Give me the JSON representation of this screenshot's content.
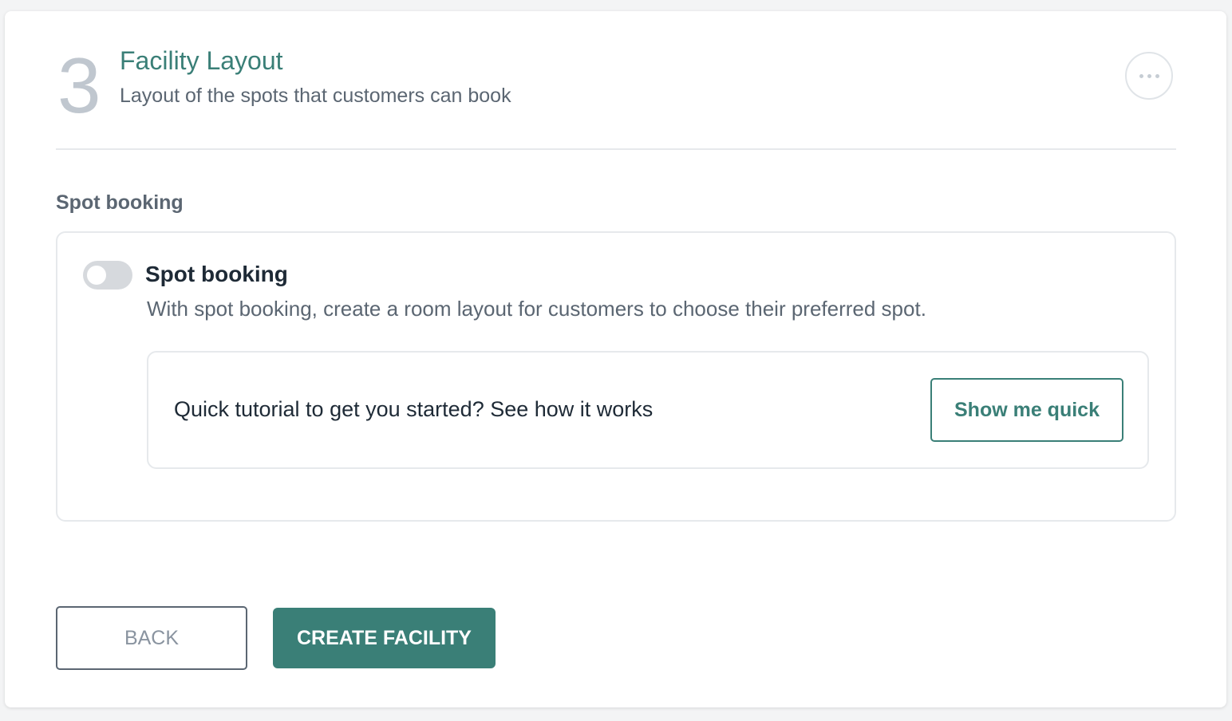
{
  "step": {
    "number": "3",
    "title": "Facility Layout",
    "subtitle": "Layout of the spots that customers can book"
  },
  "section": {
    "label": "Spot booking"
  },
  "spot_booking": {
    "toggle_label": "Spot booking",
    "toggle_enabled": false,
    "description": "With spot booking, create a room layout for customers to choose their preferred spot."
  },
  "tutorial": {
    "text": "Quick tutorial to get you started? See how it works",
    "button_label": "Show me quick"
  },
  "actions": {
    "back_label": "BACK",
    "create_label": "CREATE FACILITY"
  },
  "icons": {
    "more": "more-horizontal-icon"
  },
  "colors": {
    "accent": "#3a7f77",
    "muted_text": "#5b6672",
    "step_number": "#c0c7cf"
  }
}
